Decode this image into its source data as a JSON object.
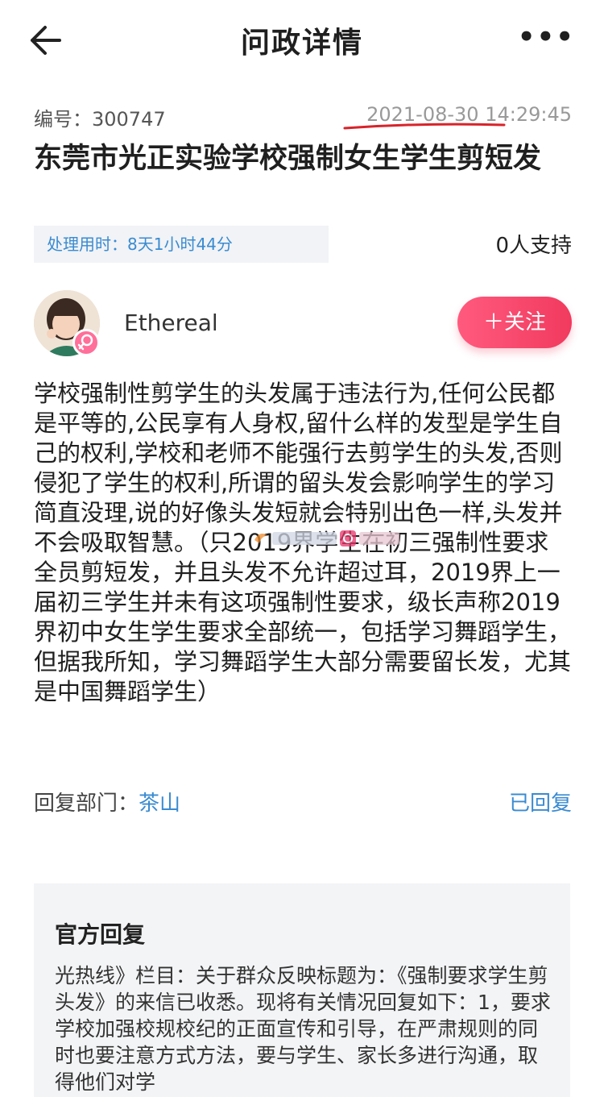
{
  "nav": {
    "title": "问政详情",
    "back_icon": "back-arrow-icon",
    "more_label": "•••"
  },
  "post": {
    "number_label": "编号：300747",
    "time": "2021-08-30 14:29:45",
    "title": "东莞市光正实验学校强制女生学生剪短发",
    "duration": "处理用时：8天1小时44分",
    "support": "0人支持"
  },
  "user": {
    "name": "Ethereal",
    "gender_icon": "female-icon",
    "follow_label": "＋关注"
  },
  "content": "学校强制性剪学生的头发属于违法行为,任何公民都是平等的,公民享有人身权,留什么样的发型是学生自己的权利,学校和老师不能强行去剪学生的头发,否则侵犯了学生的权利,所谓的留头发会影响学生的学习简直没理,说的好像头发短就会特别出色一样,头发并不会吸取智慧。（只2019界学生在初三强制性要求全员剪短发，并且头发不允许超过耳，2019界上一届初三学生并未有这项强制性要求，级长声称2019界初中女生学生要求全部统一，包括学习舞蹈学生，但据我所知，学习舞蹈学生大部分需要留长发，尤其是中国舞蹈学生）",
  "dept": {
    "label": "回复部门：",
    "value": "茶山",
    "status": "已回复"
  },
  "reply": {
    "title": "官方回复",
    "text": "光热线》栏目：关于群众反映标题为：《强制要求学生剪头发》的来信已收悉。现将有关情况回复如下：1，要求学校加强校规校纪的正面宣传和引导，在严肃规则的同时也要注意方式方法，要与学生、家长多进行沟通，取得他们对学"
  },
  "colors": {
    "accent_blue": "#3a8bd1",
    "follow_pink": "#f13a5e",
    "underline_red": "#d8232a"
  }
}
